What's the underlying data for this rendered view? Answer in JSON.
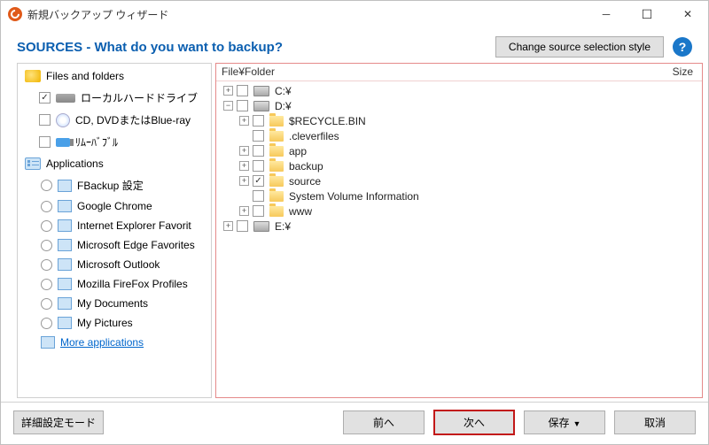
{
  "window": {
    "title": "新規バックアップ ウィザード"
  },
  "header": {
    "title": "SOURCES - What do you want to backup?",
    "change_style": "Change source selection style"
  },
  "sidebar": {
    "files_folders": "Files and folders",
    "items": [
      {
        "label": "ローカルハードドライブ",
        "checked": true,
        "icon": "hd"
      },
      {
        "label": "CD, DVDまたはBlue-ray",
        "checked": false,
        "icon": "cd"
      },
      {
        "label": "ﾘﾑｰﾊﾞﾌﾞﾙ",
        "checked": false,
        "icon": "usb"
      }
    ],
    "applications": "Applications",
    "apps": [
      {
        "label": "FBackup 設定"
      },
      {
        "label": "Google Chrome"
      },
      {
        "label": "Internet Explorer Favorit"
      },
      {
        "label": "Microsoft Edge Favorites"
      },
      {
        "label": "Microsoft Outlook"
      },
      {
        "label": "Mozilla FireFox Profiles"
      },
      {
        "label": "My Documents"
      },
      {
        "label": "My Pictures"
      }
    ],
    "more": "More applications"
  },
  "tree": {
    "header_file": "File¥Folder",
    "header_size": "Size",
    "nodes": [
      {
        "name": "C:¥",
        "type": "drive",
        "level": 0,
        "exp": "+",
        "checked": false
      },
      {
        "name": "D:¥",
        "type": "drive",
        "level": 0,
        "exp": "−",
        "checked": false
      },
      {
        "name": "$RECYCLE.BIN",
        "type": "folder",
        "level": 1,
        "exp": "+",
        "checked": false
      },
      {
        "name": ".cleverfiles",
        "type": "folder",
        "level": 1,
        "exp": "",
        "checked": false
      },
      {
        "name": "app",
        "type": "folder",
        "level": 1,
        "exp": "+",
        "checked": false
      },
      {
        "name": "backup",
        "type": "folder",
        "level": 1,
        "exp": "+",
        "checked": false
      },
      {
        "name": "source",
        "type": "folder",
        "level": 1,
        "exp": "+",
        "checked": true
      },
      {
        "name": "System Volume Information",
        "type": "folder",
        "level": 1,
        "exp": "",
        "checked": false
      },
      {
        "name": "www",
        "type": "folder",
        "level": 1,
        "exp": "+",
        "checked": false
      },
      {
        "name": "E:¥",
        "type": "drive",
        "level": 0,
        "exp": "+",
        "checked": false
      }
    ]
  },
  "footer": {
    "advanced": "詳細設定モード",
    "prev": "前へ",
    "next": "次へ",
    "save": "保存",
    "cancel": "取消"
  }
}
